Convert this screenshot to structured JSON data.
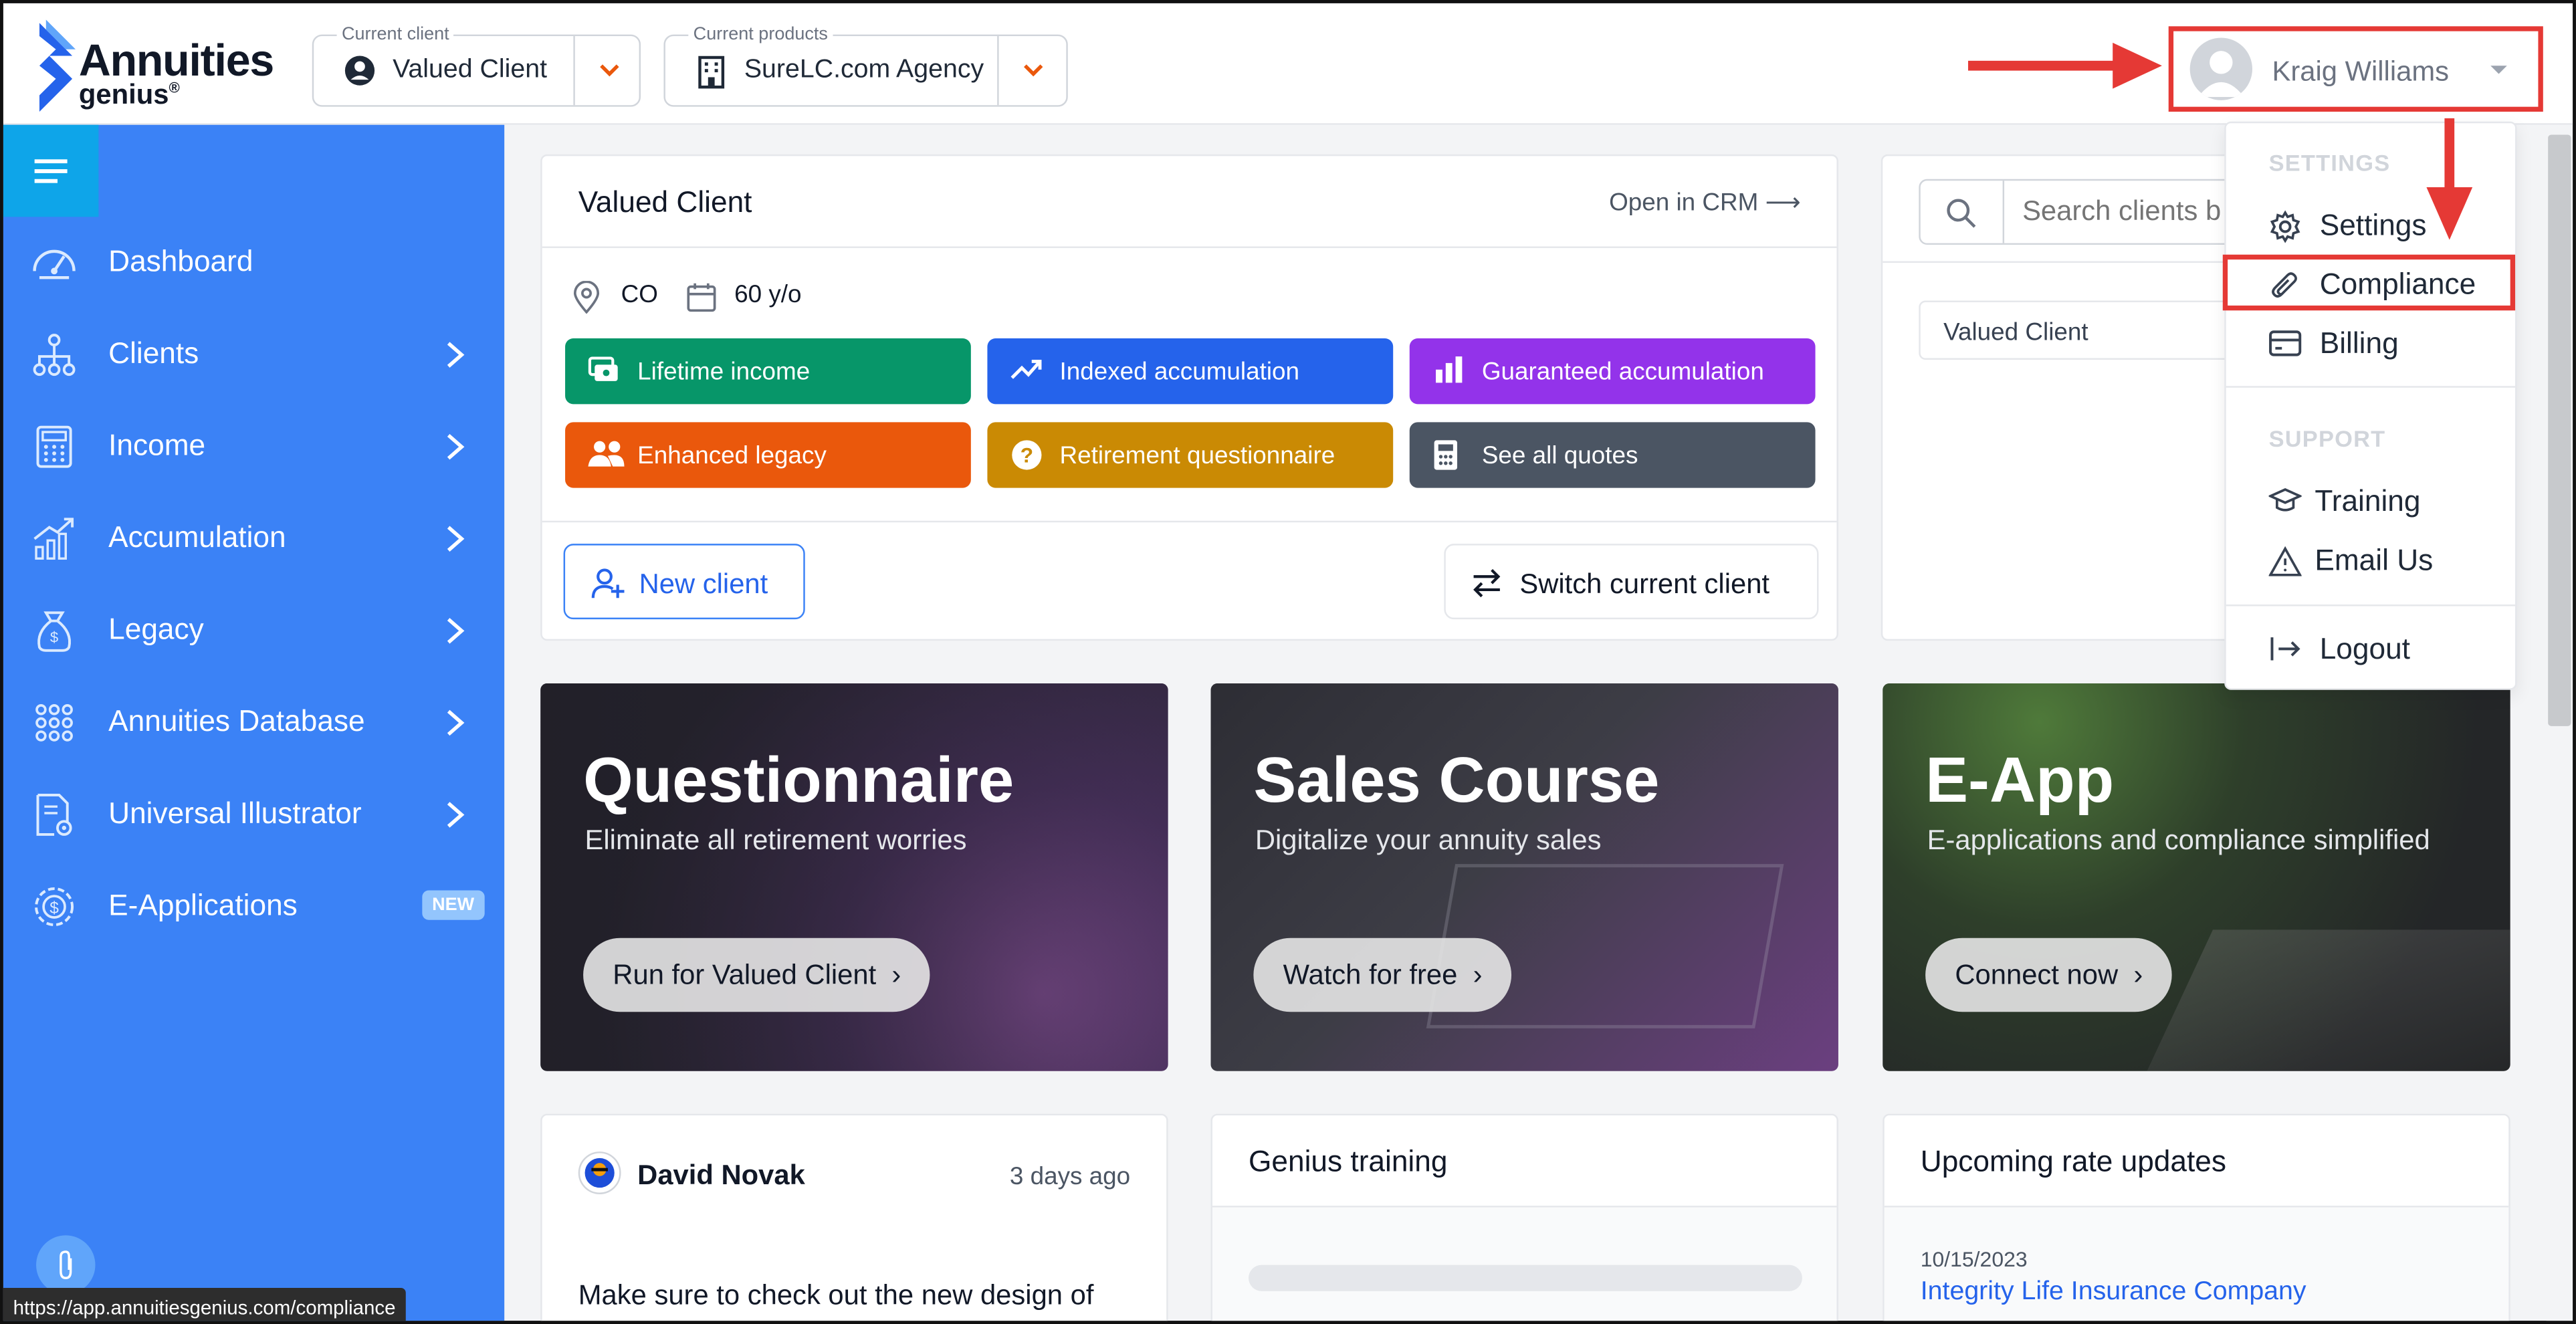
{
  "header": {
    "logo_line1": "Annuities",
    "logo_line2": "genius",
    "logo_reg": "®",
    "client_label": "Current client",
    "client_value": "Valued Client",
    "products_label": "Current products",
    "products_value": "SureLC.com Agency",
    "user_name": "Kraig Williams"
  },
  "sidebar": {
    "items": [
      {
        "label": "Dashboard"
      },
      {
        "label": "Clients"
      },
      {
        "label": "Income"
      },
      {
        "label": "Accumulation"
      },
      {
        "label": "Legacy"
      },
      {
        "label": "Annuities Database"
      },
      {
        "label": "Universal Illustrator"
      },
      {
        "label": "E-Applications",
        "badge": "NEW"
      }
    ]
  },
  "client_card": {
    "title": "Valued Client",
    "open_crm": "Open in CRM",
    "state": "CO",
    "age": "60 y/o",
    "quote_buttons": [
      {
        "label": "Lifetime income",
        "color": "#079669"
      },
      {
        "label": "Indexed accumulation",
        "color": "#2563eb"
      },
      {
        "label": "Guaranteed accumulation",
        "color": "#9333ea"
      },
      {
        "label": "Enhanced legacy",
        "color": "#ea580c"
      },
      {
        "label": "Retirement questionnaire",
        "color": "#ca8a04"
      },
      {
        "label": "See all quotes",
        "color": "#4b5563"
      }
    ],
    "new_client": "New client",
    "switch_client": "Switch current client"
  },
  "search_card": {
    "placeholder": "Search clients b",
    "result": "Valued Client"
  },
  "features": [
    {
      "title": "Questionnaire",
      "subtitle": "Eliminate all retirement worries",
      "button": "Run for Valued Client"
    },
    {
      "title": "Sales Course",
      "subtitle": "Digitalize your annuity sales",
      "button": "Watch for free"
    },
    {
      "title": "E-App",
      "subtitle": "E-applications and compliance simplified",
      "button": "Connect now"
    }
  ],
  "post_card": {
    "author": "David Novak",
    "time": "3 days ago",
    "text": "Make sure to check out the new design of"
  },
  "training_card": {
    "title": "Genius training"
  },
  "rates_card": {
    "title": "Upcoming rate updates",
    "date": "10/15/2023",
    "company": "Integrity Life Insurance Company"
  },
  "dropdown": {
    "settings_header": "SETTINGS",
    "settings": "Settings",
    "compliance": "Compliance",
    "billing": "Billing",
    "support_header": "SUPPORT",
    "training": "Training",
    "email": "Email Us",
    "logout": "Logout"
  },
  "status_url": "https://app.annuitiesgenius.com/compliance",
  "colors": {
    "sidebar": "#3b82f6",
    "accent": "#0ea5e9",
    "highlight": "#e53935"
  }
}
